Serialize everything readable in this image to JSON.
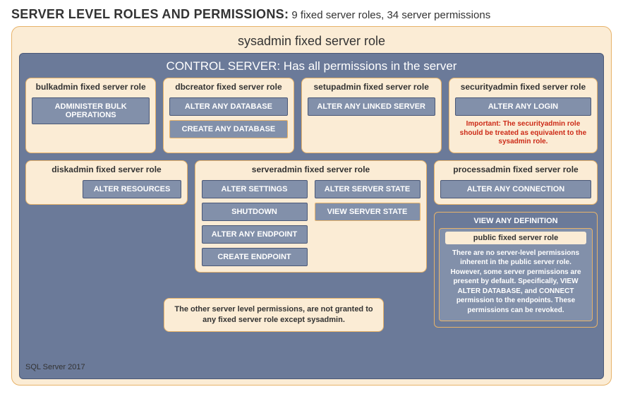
{
  "header": {
    "title_strong": "SERVER LEVEL ROLES AND PERMISSIONS:",
    "title_rest": " 9 fixed server roles, 34 server permissions"
  },
  "sysadmin": {
    "title": "sysadmin fixed server role"
  },
  "control": {
    "title": "CONTROL SERVER: Has all permissions in the server"
  },
  "roles": {
    "bulkadmin": {
      "title": "bulkadmin fixed server role",
      "perm1": "ADMINISTER BULK OPERATIONS"
    },
    "dbcreator": {
      "title": "dbcreator fixed server role",
      "perm1": "ALTER ANY DATABASE",
      "perm2": "CREATE ANY DATABASE"
    },
    "setupadmin": {
      "title": "setupadmin fixed server role",
      "perm1": "ALTER ANY LINKED SERVER"
    },
    "securityadmin": {
      "title": "securityadmin fixed server role",
      "perm1": "ALTER ANY LOGIN",
      "note": "Important: The securityadmin role should be treated as equivalent to the sysadmin role."
    },
    "diskadmin": {
      "title": "diskadmin fixed server role",
      "perm1": "ALTER RESOURCES"
    },
    "serveradmin": {
      "title": "serveradmin fixed server role",
      "c1p1": "ALTER SETTINGS",
      "c1p2": "SHUTDOWN",
      "c1p3": "ALTER ANY ENDPOINT",
      "c1p4": "CREATE ENDPOINT",
      "c2p1": "ALTER SERVER STATE",
      "c2p2": "VIEW SERVER STATE"
    },
    "processadmin": {
      "title": "processadmin fixed server role",
      "perm1": "ALTER ANY CONNECTION"
    },
    "viewdef": {
      "title": "VIEW ANY DEFINITION",
      "public_title": "public fixed server role",
      "public_body": "There are no server-level permissions inherent in the public server role. However, some server permissions are present by default. Specifically, VIEW ALTER DATABASE, and CONNECT permission to the endpoints. These permissions can be revoked."
    }
  },
  "notes": {
    "other_perms": "The other server level permissions, are not granted to any fixed server role except sysadmin."
  },
  "footer": {
    "product": "SQL Server 2017"
  }
}
